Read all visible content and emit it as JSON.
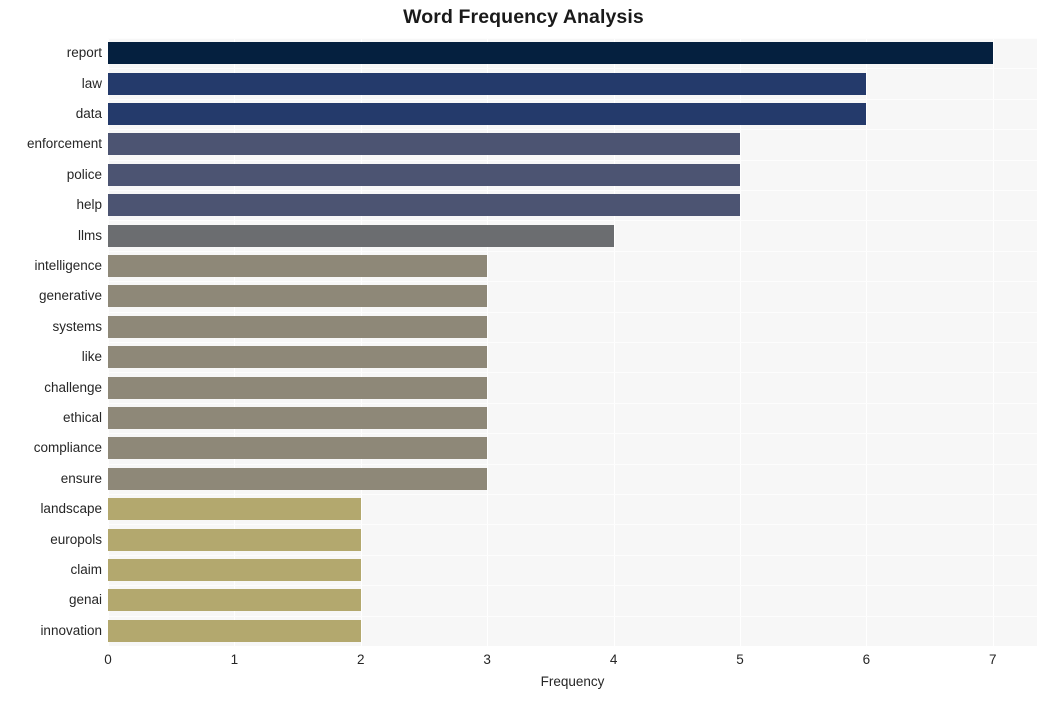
{
  "chart_data": {
    "type": "bar",
    "orientation": "horizontal",
    "title": "Word Frequency Analysis",
    "xlabel": "Frequency",
    "ylabel": "",
    "xlim": [
      0,
      7.35
    ],
    "xticks": [
      0,
      1,
      2,
      3,
      4,
      5,
      6,
      7
    ],
    "xtick_labels": [
      "0",
      "1",
      "2",
      "3",
      "4",
      "5",
      "6",
      "7"
    ],
    "grid": true,
    "grid_axis": "both",
    "grid_color": "#ffffff",
    "legend": false,
    "plot_background": "#f7f7f7",
    "figure_background": "#ffffff",
    "categories": [
      "report",
      "law",
      "data",
      "enforcement",
      "police",
      "help",
      "llms",
      "intelligence",
      "generative",
      "systems",
      "like",
      "challenge",
      "ethical",
      "compliance",
      "ensure",
      "landscape",
      "europols",
      "claim",
      "genai",
      "innovation"
    ],
    "values": [
      7,
      6,
      6,
      5,
      5,
      5,
      4,
      3,
      3,
      3,
      3,
      3,
      3,
      3,
      3,
      2,
      2,
      2,
      2,
      2
    ],
    "bar_colors": [
      "#05203f",
      "#243a6b",
      "#243a6b",
      "#4c5472",
      "#4c5472",
      "#4c5472",
      "#6b6d70",
      "#8e8878",
      "#8e8878",
      "#8e8878",
      "#8e8878",
      "#8e8878",
      "#8e8878",
      "#8e8878",
      "#8e8878",
      "#b3a86e",
      "#b3a86e",
      "#b3a86e",
      "#b3a86e",
      "#b3a86e"
    ]
  }
}
